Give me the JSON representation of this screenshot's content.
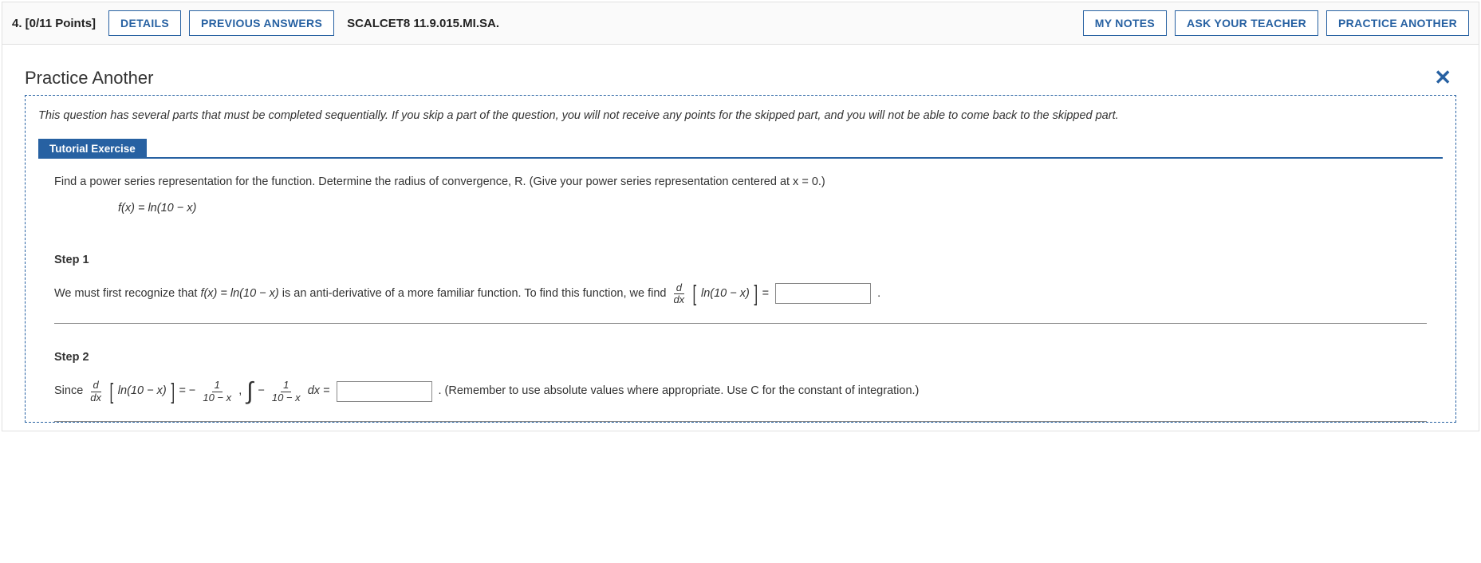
{
  "header": {
    "question_label": "4. [0/11 Points]",
    "details_btn": "DETAILS",
    "prev_answers_btn": "PREVIOUS ANSWERS",
    "source_label": "SCALCET8 11.9.015.MI.SA.",
    "my_notes_btn": "MY NOTES",
    "ask_teacher_btn": "ASK YOUR TEACHER",
    "practice_another_btn": "PRACTICE ANOTHER"
  },
  "panel": {
    "title": "Practice Another",
    "instruction": "This question has several parts that must be completed sequentially. If you skip a part of the question, you will not receive any points for the skipped part, and you will not be able to come back to the skipped part.",
    "tutorial_tab": "Tutorial Exercise",
    "exercise_prompt": "Find a power series representation for the function. Determine the radius of convergence, R. (Give your power series representation centered at x = 0.)",
    "fx_expr": "f(x) = ln(10 − x)"
  },
  "step1": {
    "title": "Step 1",
    "pre": "We must first recognize that ",
    "fx": "f(x) = ln(10 − x)",
    "mid": " is an anti-derivative of a more familiar function. To find this function, we find ",
    "ddx_num": "d",
    "ddx_den": "dx",
    "ln_expr": "ln(10 − x)",
    "equals": " = ",
    "tail": " ."
  },
  "step2": {
    "title": "Step 2",
    "since": "Since ",
    "ddx_num": "d",
    "ddx_den": "dx",
    "ln_expr": "ln(10 − x)",
    "eq1": " = − ",
    "frac1_num": "1",
    "frac1_den": "10 − x",
    "comma": ", ",
    "neg": " − ",
    "frac2_num": "1",
    "frac2_den": "10 − x",
    "dx": " dx = ",
    "tail": " .  (Remember to use absolute values where appropriate. Use C for the constant of integration.)"
  }
}
